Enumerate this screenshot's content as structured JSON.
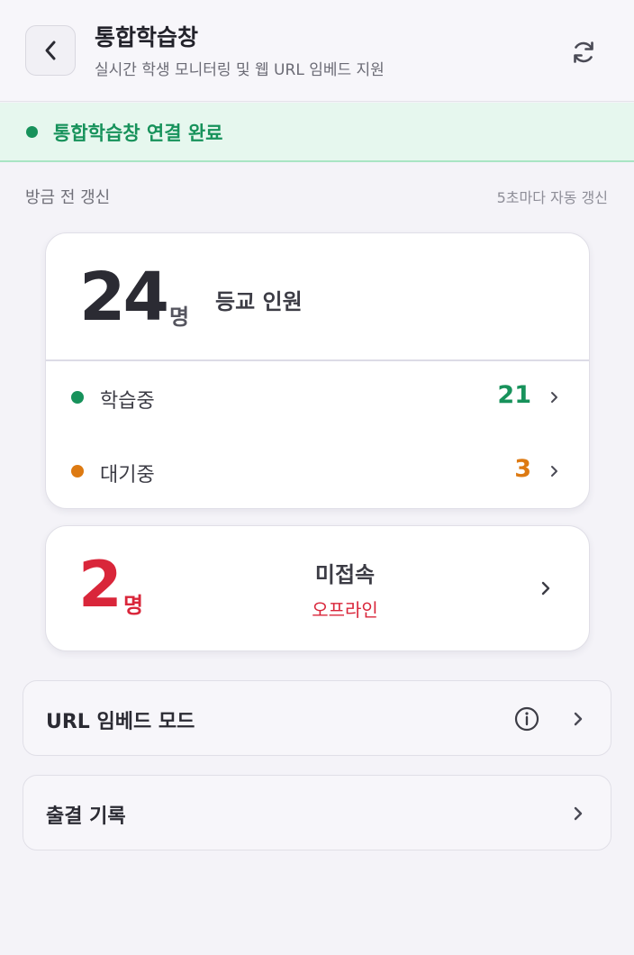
{
  "header": {
    "title": "통합학습창",
    "subtitle": "실시간 학생 모니터링 및 웹 URL 임베드 지원",
    "back_icon": "chevron-left-icon",
    "refresh_icon": "refresh-icon"
  },
  "banner": {
    "status_text": "통합학습창 연결 완료",
    "status_color": "#17925b"
  },
  "updated": {
    "last_updated": "방금 전 갱신",
    "auto_refresh": "5초마다 자동 갱신"
  },
  "attendance": {
    "count": "24",
    "unit": "명",
    "label": "등교 인원",
    "rows": [
      {
        "label": "학습중",
        "value": "21",
        "color": "#17925b"
      },
      {
        "label": "대기중",
        "value": "3",
        "color": "#dd7a12"
      }
    ]
  },
  "offline": {
    "count": "2",
    "unit": "명",
    "title": "미접속",
    "subtitle": "오프라인",
    "color": "#d9263a"
  },
  "menu": {
    "url_embed": "URL 임베드 모드",
    "attendance_log": "출결 기록"
  }
}
